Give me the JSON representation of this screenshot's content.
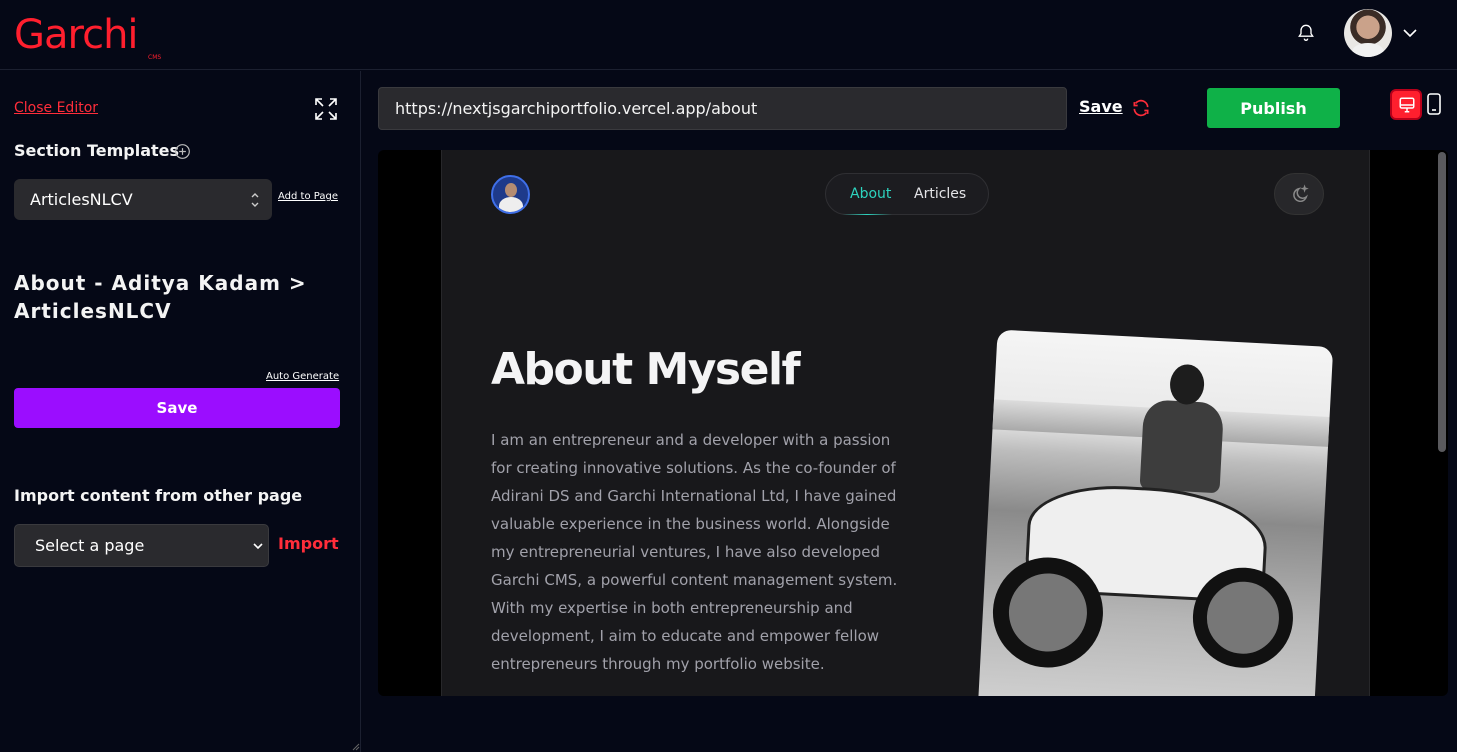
{
  "header": {
    "logo": "Garchi",
    "logo_sub": "CMS",
    "icons": {
      "notifications": "bell-icon",
      "account_menu": "chevron-down-icon"
    }
  },
  "sidebar": {
    "close_editor": "Close Editor",
    "section_templates_label": "Section Templates",
    "template_selected": "ArticlesNLCV",
    "add_to_page": "Add to Page",
    "breadcrumb": "About - Aditya Kadam > ArticlesNLCV",
    "auto_generate": "Auto Generate",
    "save_label": "Save",
    "import_heading": "Import content from other page",
    "page_select_placeholder": "Select a page",
    "import_label": "Import"
  },
  "toolbar": {
    "url": "https://nextjsgarchiportfolio.vercel.app/about",
    "save_label": "Save",
    "publish_label": "Publish",
    "view_mode": "desktop"
  },
  "preview": {
    "nav": [
      "About",
      "Articles"
    ],
    "active_nav": "About",
    "title": "About Myself",
    "body": "I am an entrepreneur and a developer with a passion for creating innovative solutions. As the co-founder of Adirani DS and Garchi International Ltd, I have gained valuable experience in the business world. Alongside my entrepreneurial ventures, I have also developed Garchi CMS, a powerful content management system. With my expertise in both entrepreneurship and development, I aim to educate and empower fellow entrepreneurs through my portfolio website."
  },
  "colors": {
    "brand_red": "#ff1f2e",
    "save_purple": "#9b0dff",
    "publish_green": "#0fb148",
    "nav_active": "#2dd4bf"
  }
}
